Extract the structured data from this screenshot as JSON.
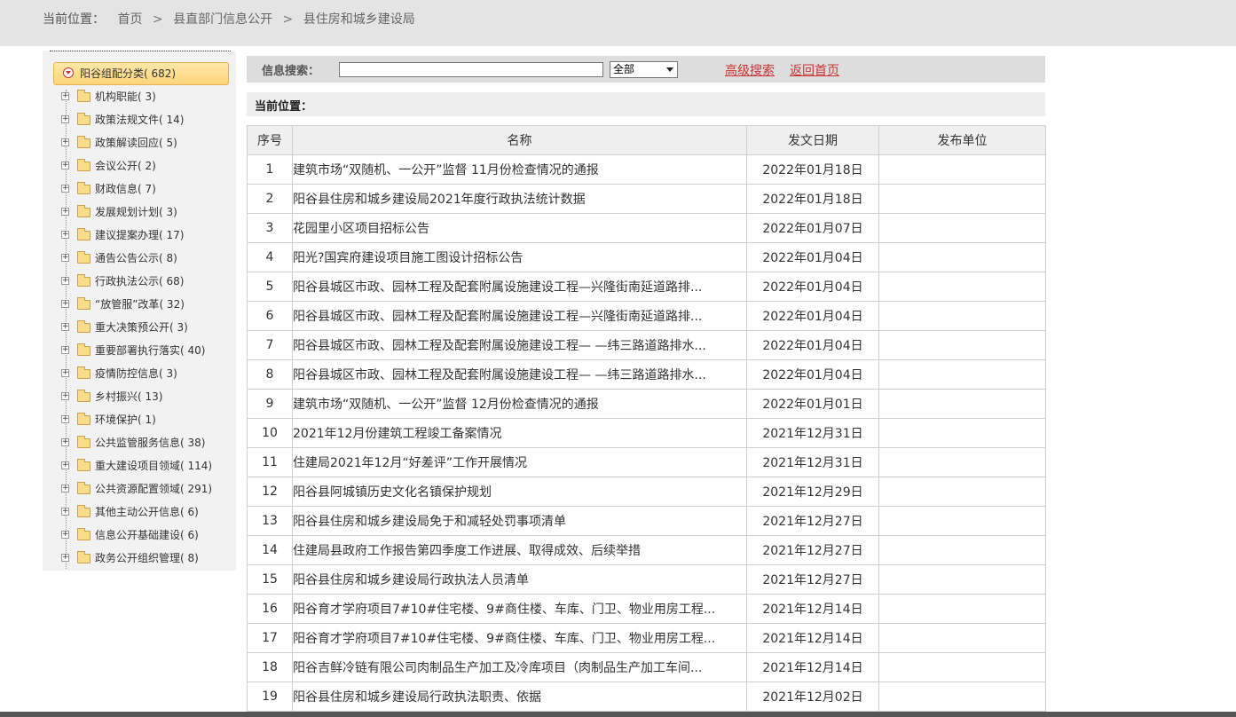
{
  "breadcrumb": {
    "label": "当前位置：",
    "items": [
      "首页",
      "县直部门信息公开",
      "县住房和城乡建设局"
    ],
    "separator": ">"
  },
  "sidebar": {
    "root": {
      "label": "阳谷组配分类",
      "count": "( 682)"
    },
    "items": [
      {
        "label": "机构职能",
        "count": "( 3)"
      },
      {
        "label": "政策法规文件",
        "count": "( 14)"
      },
      {
        "label": "政策解读回应",
        "count": "( 5)"
      },
      {
        "label": "会议公开",
        "count": "( 2)"
      },
      {
        "label": "财政信息",
        "count": "( 7)"
      },
      {
        "label": "发展规划计划",
        "count": "( 3)"
      },
      {
        "label": "建议提案办理",
        "count": "( 17)"
      },
      {
        "label": "通告公告公示",
        "count": "( 8)"
      },
      {
        "label": "行政执法公示",
        "count": "( 68)"
      },
      {
        "label": "“放管服”改革",
        "count": "( 32)"
      },
      {
        "label": "重大决策预公开",
        "count": "( 3)"
      },
      {
        "label": "重要部署执行落实",
        "count": "( 40)"
      },
      {
        "label": "疫情防控信息",
        "count": "( 3)"
      },
      {
        "label": "乡村振兴",
        "count": "( 13)"
      },
      {
        "label": "环境保护",
        "count": "( 1)"
      },
      {
        "label": "公共监管服务信息",
        "count": "( 38)"
      },
      {
        "label": "重大建设项目领域",
        "count": "( 114)"
      },
      {
        "label": "公共资源配置领域",
        "count": "( 291)"
      },
      {
        "label": "其他主动公开信息",
        "count": "( 6)"
      },
      {
        "label": "信息公开基础建设",
        "count": "( 6)"
      },
      {
        "label": "政务公开组织管理",
        "count": "( 8)"
      }
    ]
  },
  "search": {
    "label": "信息搜索：",
    "value": "",
    "select_value": "全部",
    "advanced_link": "高级搜索",
    "home_link": "返回首页"
  },
  "position": {
    "label": "当前位置："
  },
  "table": {
    "headers": [
      "序号",
      "名称",
      "发文日期",
      "发布单位"
    ],
    "rows": [
      {
        "no": "1",
        "name": "建筑市场“双随机、一公开”监督 11月份检查情况的通报",
        "date": "2022年01月18日",
        "unit": ""
      },
      {
        "no": "2",
        "name": "阳谷县住房和城乡建设局2021年度行政执法统计数据",
        "date": "2022年01月18日",
        "unit": ""
      },
      {
        "no": "3",
        "name": "花园里小区项目招标公告",
        "date": "2022年01月07日",
        "unit": ""
      },
      {
        "no": "4",
        "name": "阳光?国宾府建设项目施工图设计招标公告",
        "date": "2022年01月04日",
        "unit": ""
      },
      {
        "no": "5",
        "name": "阳谷县城区市政、园林工程及配套附属设施建设工程—兴隆街南延道路排...",
        "date": "2022年01月04日",
        "unit": ""
      },
      {
        "no": "6",
        "name": "阳谷县城区市政、园林工程及配套附属设施建设工程—兴隆街南延道路排...",
        "date": "2022年01月04日",
        "unit": ""
      },
      {
        "no": "7",
        "name": "阳谷县城区市政、园林工程及配套附属设施建设工程— —纬三路道路排水...",
        "date": "2022年01月04日",
        "unit": ""
      },
      {
        "no": "8",
        "name": "阳谷县城区市政、园林工程及配套附属设施建设工程— —纬三路道路排水...",
        "date": "2022年01月04日",
        "unit": ""
      },
      {
        "no": "9",
        "name": "建筑市场“双随机、一公开”监督 12月份检查情况的通报",
        "date": "2022年01月01日",
        "unit": ""
      },
      {
        "no": "10",
        "name": "2021年12月份建筑工程竣工备案情况",
        "date": "2021年12月31日",
        "unit": ""
      },
      {
        "no": "11",
        "name": "住建局2021年12月“好差评”工作开展情况",
        "date": "2021年12月31日",
        "unit": ""
      },
      {
        "no": "12",
        "name": "阳谷县阿城镇历史文化名镇保护规划",
        "date": "2021年12月29日",
        "unit": ""
      },
      {
        "no": "13",
        "name": "阳谷县住房和城乡建设局免于和减轻处罚事项清单",
        "date": "2021年12月27日",
        "unit": ""
      },
      {
        "no": "14",
        "name": "住建局县政府工作报告第四季度工作进展、取得成效、后续举措",
        "date": "2021年12月27日",
        "unit": ""
      },
      {
        "no": "15",
        "name": "阳谷县住房和城乡建设局行政执法人员清单",
        "date": "2021年12月27日",
        "unit": ""
      },
      {
        "no": "16",
        "name": "阳谷育才学府项目7#10#住宅楼、9#商住楼、车库、门卫、物业用房工程...",
        "date": "2021年12月14日",
        "unit": ""
      },
      {
        "no": "17",
        "name": "阳谷育才学府项目7#10#住宅楼、9#商住楼、车库、门卫、物业用房工程...",
        "date": "2021年12月14日",
        "unit": ""
      },
      {
        "no": "18",
        "name": "阳谷吉鲜冷链有限公司肉制品生产加工及冷库项目（肉制品生产加工车间...",
        "date": "2021年12月14日",
        "unit": ""
      },
      {
        "no": "19",
        "name": "阳谷县住房和城乡建设局行政执法职责、依据",
        "date": "2021年12月02日",
        "unit": ""
      }
    ]
  }
}
